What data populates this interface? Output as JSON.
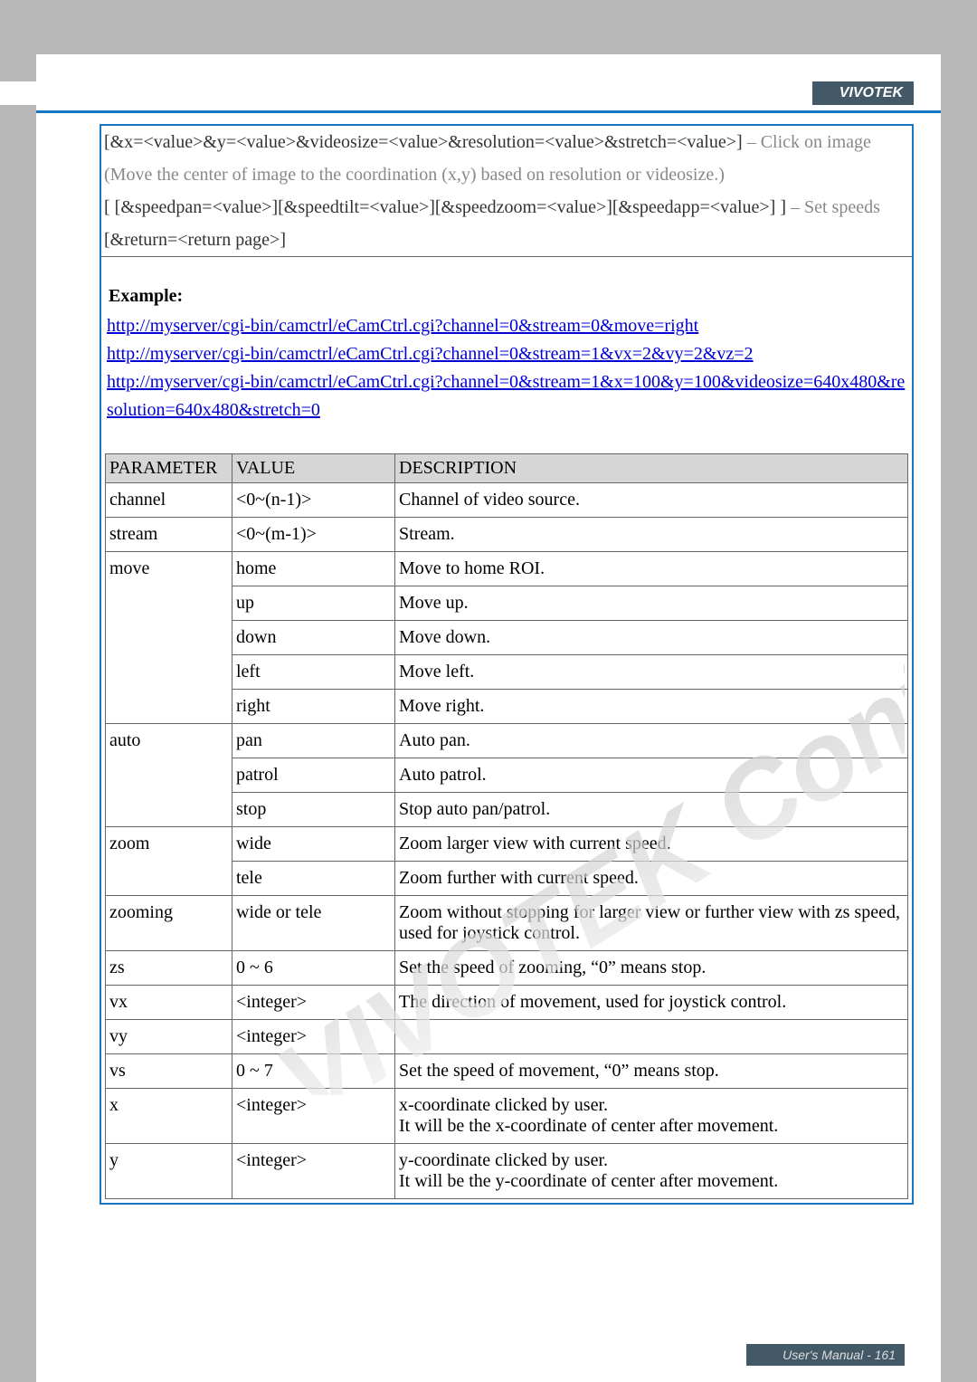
{
  "brand": "VIVOTEK",
  "footer": "User's Manual - 161",
  "syntax": {
    "line1_code": "[&x=<value>&y=<value>&videosize=<value>&resolution=<value>&stretch=<value>]",
    "line1_note": " – Click on image",
    "line2": "(Move the center of image to the coordination (x,y) based on resolution or videosize.)",
    "line3_code": "[ [&speedpan=<value>][&speedtilt=<value>][&speedzoom=<value>][&speedapp=<value>] ]",
    "line3_note": " – Set speeds",
    "line4": "[&return=<return page>]"
  },
  "example": {
    "title": "Example:",
    "links": [
      "http://myserver/cgi-bin/camctrl/eCamCtrl.cgi?channel=0&stream=0&move=right",
      "http://myserver/cgi-bin/camctrl/eCamCtrl.cgi?channel=0&stream=1&vx=2&vy=2&vz=2",
      "http://myserver/cgi-bin/camctrl/eCamCtrl.cgi?channel=0&stream=1&x=100&y=100&videosize=640x480&resolution=640x480&stretch=0"
    ]
  },
  "table": {
    "headers": {
      "param": "PARAMETER",
      "value": "VALUE",
      "desc": "DESCRIPTION"
    },
    "rows": [
      {
        "param": "channel",
        "values": [
          "<0~(n-1)>"
        ],
        "descs": [
          "Channel of video source."
        ]
      },
      {
        "param": "stream",
        "values": [
          "<0~(m-1)>"
        ],
        "descs": [
          "Stream."
        ]
      },
      {
        "param": "move",
        "values": [
          "home",
          "up",
          "down",
          "left",
          "right"
        ],
        "descs": [
          "Move to home ROI.",
          "Move up.",
          "Move down.",
          "Move left.",
          "Move right."
        ]
      },
      {
        "param": "auto",
        "values": [
          "pan",
          "patrol",
          "stop"
        ],
        "descs": [
          "Auto pan.",
          "Auto patrol.",
          "Stop auto pan/patrol."
        ]
      },
      {
        "param": "zoom",
        "values": [
          "wide",
          "tele"
        ],
        "descs": [
          "Zoom larger view with current speed.",
          "Zoom further with current speed."
        ]
      },
      {
        "param": "zooming",
        "values": [
          "wide or tele"
        ],
        "descs": [
          "Zoom without stopping for larger view or further view with zs speed, used for joystick control."
        ]
      },
      {
        "param": "zs",
        "values": [
          "0 ~ 6"
        ],
        "descs": [
          "Set the speed of zooming, “0” means stop."
        ]
      },
      {
        "param": "vx",
        "values": [
          "<integer>"
        ],
        "descs": [
          "The direction of movement, used for joystick control."
        ]
      },
      {
        "param": "vy",
        "values": [
          "<integer>"
        ],
        "descs": [
          ""
        ]
      },
      {
        "param": "vs",
        "values": [
          "0 ~ 7"
        ],
        "descs": [
          "Set the speed of movement, “0” means stop."
        ]
      },
      {
        "param": "x",
        "values": [
          "<integer>"
        ],
        "descs": [
          "x-coordinate clicked by user.\nIt will be the x-coordinate of center after movement."
        ]
      },
      {
        "param": "y",
        "values": [
          "<integer>"
        ],
        "descs": [
          "y-coordinate clicked by user.\nIt will be the y-coordinate of center after movement."
        ]
      }
    ]
  }
}
